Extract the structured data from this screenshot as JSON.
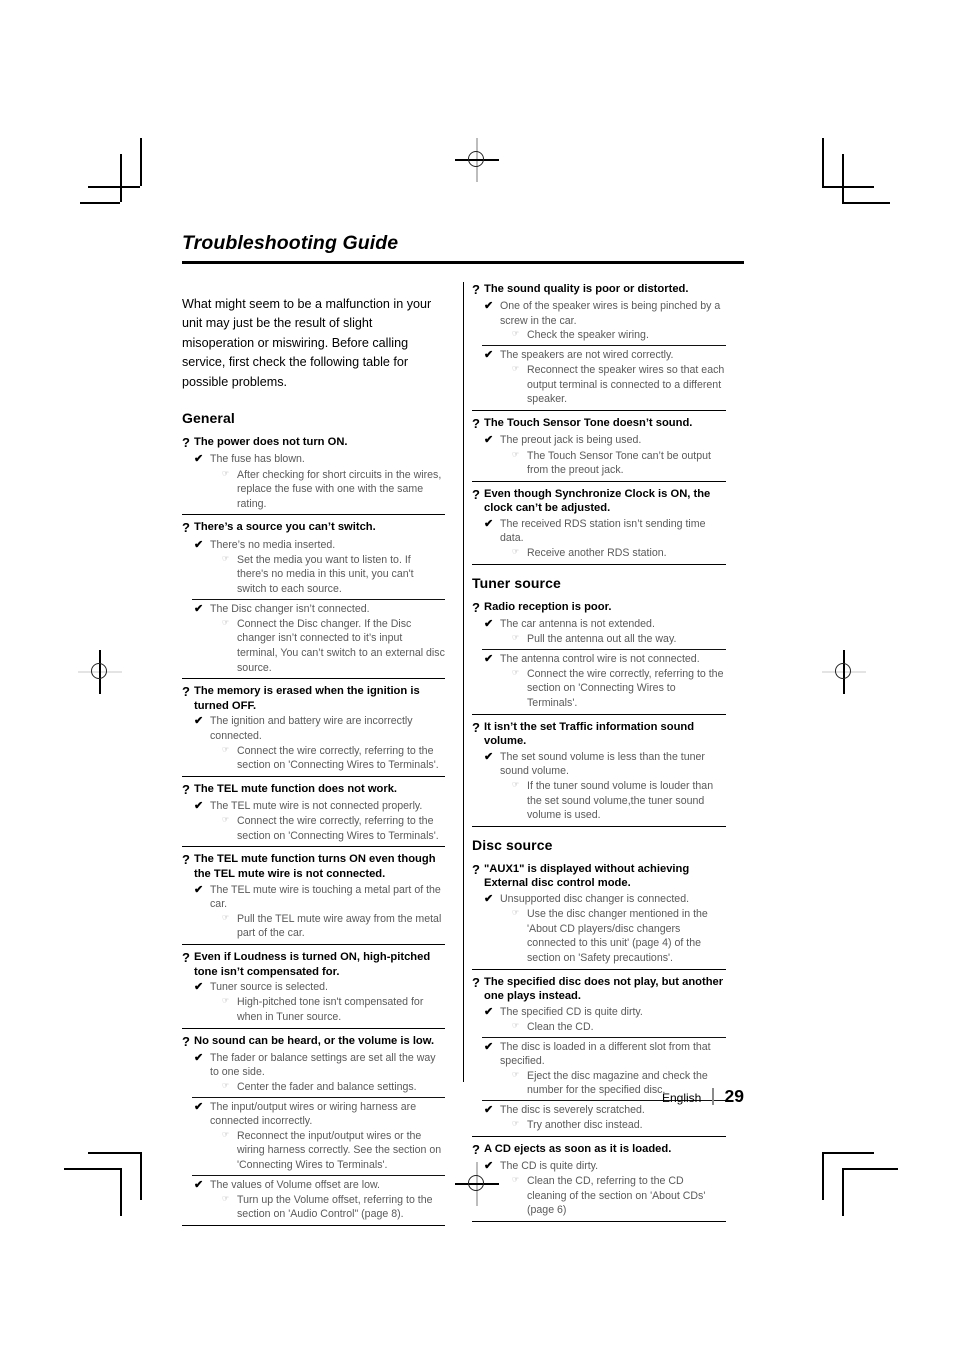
{
  "document": {
    "title": "Troubleshooting Guide",
    "intro": "What might seem to be a malfunction in your unit may just be the result of slight misoperation or miswiring. Before calling service, first check the following table for possible problems.",
    "footer": {
      "language": "English",
      "page_number": "29"
    },
    "glyphs": {
      "question": "?",
      "check": "✔",
      "pointer": "☞"
    }
  },
  "left_column": {
    "section_heading": "General",
    "entries": [
      {
        "question": "The power does not turn ON.",
        "causes": [
          {
            "cause": "The fuse has blown.",
            "fix": "After checking for short circuits in the wires, replace the fuse with one with the same rating."
          }
        ]
      },
      {
        "question": "There’s a source you can’t switch.",
        "causes": [
          {
            "cause": "There’s no media inserted.",
            "fix": "Set the media you want to listen to. If there's no media in this unit, you can't switch to each source."
          },
          {
            "cause": "The Disc changer isn’t connected.",
            "fix": "Connect the Disc changer. If the Disc changer isn’t connected to it’s input terminal, You can’t switch to an external disc source."
          }
        ]
      },
      {
        "question": "The memory is erased when the ignition is turned OFF.",
        "causes": [
          {
            "cause": "The ignition and battery wire are incorrectly connected.",
            "fix": "Connect the wire correctly, referring to the section on 'Connecting Wires to Terminals'."
          }
        ]
      },
      {
        "question": "The TEL mute function does not work.",
        "causes": [
          {
            "cause": "The TEL mute wire is not connected properly.",
            "fix": "Connect the wire correctly, referring to the section on 'Connecting Wires to Terminals'."
          }
        ]
      },
      {
        "question": "The TEL mute function turns ON even though the TEL mute wire is not connected.",
        "causes": [
          {
            "cause": "The TEL mute wire is touching a metal part of the car.",
            "fix": "Pull the TEL mute wire away from the metal part of the car."
          }
        ]
      },
      {
        "question": "Even if Loudness is turned ON, high-pitched tone isn’t compensated for.",
        "causes": [
          {
            "cause": "Tuner source is selected.",
            "fix": "High-pitched tone isn't compensated for when in Tuner source."
          }
        ]
      },
      {
        "question": "No sound can be heard, or the volume is low.",
        "causes": [
          {
            "cause": "The fader or balance settings are set all the way to one side.",
            "fix": "Center the fader and balance settings."
          },
          {
            "cause": "The input/output wires or wiring harness are connected incorrectly.",
            "fix": "Reconnect the input/output wires or the wiring harness correctly. See the section on 'Connecting Wires to Terminals'."
          },
          {
            "cause": "The values of Volume offset are low.",
            "fix": "Turn up the Volume offset, referring to the section on 'Audio Control\" (page 8)."
          }
        ]
      }
    ]
  },
  "right_column": {
    "groups": [
      {
        "section_heading": "",
        "entries": [
          {
            "question": "The sound quality is poor or distorted.",
            "causes": [
              {
                "cause": "One of the speaker wires is being pinched by a screw in the car.",
                "fix": "Check the speaker wiring."
              },
              {
                "cause": "The speakers are not wired correctly.",
                "fix": "Reconnect the speaker wires so that each output terminal is connected to a different speaker."
              }
            ]
          },
          {
            "question": "The Touch Sensor Tone doesn’t sound.",
            "causes": [
              {
                "cause": "The preout jack is being used.",
                "fix": "The Touch Sensor Tone can’t be output from the preout jack."
              }
            ]
          },
          {
            "question": "Even though Synchronize Clock is ON, the clock can’t be adjusted.",
            "causes": [
              {
                "cause": "The received RDS station isn’t sending time data.",
                "fix": "Receive another RDS station."
              }
            ]
          }
        ]
      },
      {
        "section_heading": "Tuner source",
        "entries": [
          {
            "question": "Radio reception is poor.",
            "causes": [
              {
                "cause": "The car antenna is not extended.",
                "fix": "Pull the antenna out all the way."
              },
              {
                "cause": "The antenna control wire is not connected.",
                "fix": "Connect the wire correctly, referring to the section on 'Connecting Wires to Terminals'."
              }
            ]
          },
          {
            "question": "It isn’t the set Traffic information sound volume.",
            "causes": [
              {
                "cause": "The set sound volume is less than the tuner sound volume.",
                "fix": "If the tuner sound volume is louder than the set sound volume,the tuner sound volume is used."
              }
            ]
          }
        ]
      },
      {
        "section_heading": "Disc source",
        "entries": [
          {
            "question": "\"AUX1\" is displayed without achieving External disc control mode.",
            "causes": [
              {
                "cause": "Unsupported disc changer is connected.",
                "fix": "Use the disc changer mentioned in the 'About CD players/disc changers connected to this unit' (page 4) of the section on 'Safety precautions'."
              }
            ]
          },
          {
            "question": "The specified disc does not play, but another one plays instead.",
            "causes": [
              {
                "cause": "The specified CD is quite dirty.",
                "fix": "Clean the CD."
              },
              {
                "cause": "The disc is loaded in a different slot from that specified.",
                "fix": "Eject the disc magazine and check the number for the specified disc."
              },
              {
                "cause": "The disc is severely scratched.",
                "fix": "Try another disc instead."
              }
            ]
          },
          {
            "question": "A CD ejects as soon as it is loaded.",
            "causes": [
              {
                "cause": "The CD is quite dirty.",
                "fix": "Clean the CD, referring to the CD cleaning of the section on 'About CDs' (page 6)"
              }
            ]
          }
        ]
      }
    ]
  }
}
